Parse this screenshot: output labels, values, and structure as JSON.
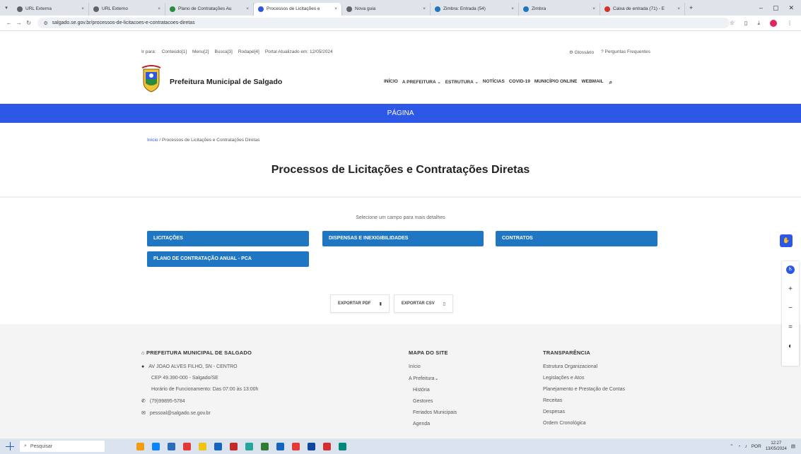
{
  "browser": {
    "tabs": [
      {
        "label": "URL Externa",
        "active": false
      },
      {
        "label": "URL Externo",
        "active": false
      },
      {
        "label": "Plano de Contratações Au",
        "active": false
      },
      {
        "label": "Processos de Licitações e",
        "active": true
      },
      {
        "label": "Nova guia",
        "active": false
      },
      {
        "label": "Zimbra: Entrada (54)",
        "active": false
      },
      {
        "label": "Zimbra",
        "active": false
      },
      {
        "label": "Caixa de entrada (71) - E",
        "active": false
      }
    ],
    "url": "salgado.se.gov.br/processos-de-licitacoes-e-contratacoes-diretas"
  },
  "site": {
    "strip_links": [
      "Ir para:",
      "Conteúdo[1]",
      "Menu[2]",
      "Busca[3]",
      "Rodapé[4]",
      "Portal Atualizado em: 12/05/2024"
    ],
    "strip_right": [
      "Glossário",
      "Perguntas Frequentes"
    ],
    "name": "Prefeitura Municipal de Salgado",
    "nav": [
      "INÍCIO",
      "A PREFEITURA ⌄",
      "ESTRUTURA ⌄",
      "NOTÍCIAS",
      "COVID-19",
      "MUNICÍPIO ONLINE",
      "WEBMAIL"
    ],
    "band_title": "PÁGINA",
    "breadcrumb_home": "Início",
    "breadcrumb_current": " / Processos de Licitações e Contratações Diretas",
    "page_title": "Processos de Licitações e Contratações Diretas",
    "select_hint": "Selecione um campo para mais detalhes",
    "categories": [
      "LICITAÇÕES",
      "DISPENSAS E INEXIGIBILIDADES",
      "CONTRATOS",
      "PLANO DE CONTRATAÇÃO ANUAL - PCA"
    ],
    "export": [
      "EXPORTAR PDF",
      "EXPORTAR CSV"
    ]
  },
  "footer": {
    "col1_head": "PREFEITURA MUNICIPAL DE SALGADO",
    "address": "AV JOAO ALVES FILHO, SN - CENTRO",
    "cep": "CEP 49.390-000 - Salgado/SE",
    "hours": "Horário de Funcionamento: Das 07:00 às 13:00h",
    "phone": "(79)99895-5784",
    "email": "pessoal@salgado.se.gov.br",
    "col2_head": "MAPA DO SITE",
    "col2_items": [
      "Início",
      "A Prefeitura⌄",
      "História",
      "Gestores",
      "Feriados Municipais",
      "Agenda"
    ],
    "col3_head": "TRANSPARÊNCIA",
    "col3_items": [
      "Estrutura Organizacional",
      "Legislações e Atos",
      "Planejamento e Prestação de Contas",
      "Receitas",
      "Despesas",
      "Ordem Cronológica"
    ]
  },
  "taskbar": {
    "search": "Pesquisar",
    "lang": "POR",
    "time": "12:27",
    "date": "13/05/2024"
  },
  "colors": {
    "band": "#2d57e6",
    "category_button": "#1f76c2"
  }
}
